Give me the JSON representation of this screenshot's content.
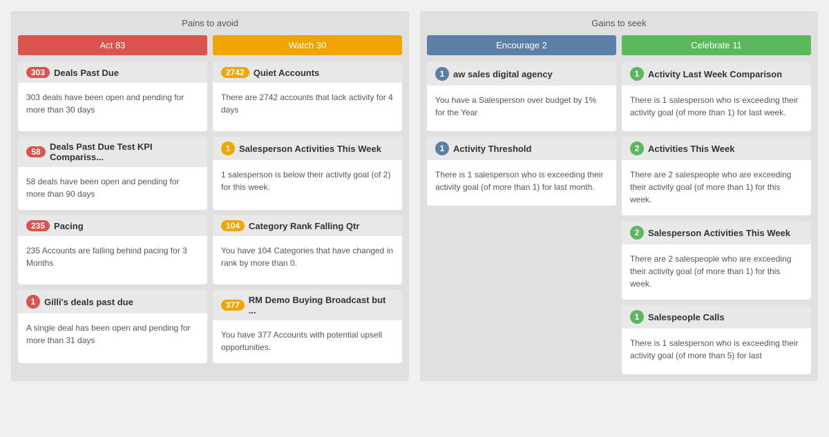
{
  "panels": [
    {
      "id": "pains",
      "title": "Pains to avoid",
      "tabs": [
        {
          "label": "Act  83",
          "color": "red"
        },
        {
          "label": "Watch  30",
          "color": "orange"
        }
      ],
      "cards": [
        {
          "badge": "303",
          "badge_color": "red",
          "title": "Deals Past Due",
          "body": "303 deals have been open and pending for more than 30 days"
        },
        {
          "badge": "2742",
          "badge_color": "orange",
          "title": "Quiet Accounts",
          "body": "There are 2742 accounts that lack activity for 4 days"
        },
        {
          "badge": "58",
          "badge_color": "red",
          "title": "Deals Past Due Test KPI Compariss...",
          "body": "58 deals have been open and pending for more than 90 days"
        },
        {
          "badge": "1",
          "badge_color": "orange",
          "badge_circle": true,
          "title": "Salesperson Activities This Week",
          "body": "1 salesperson is below their activity goal (of 2) for this week."
        },
        {
          "badge": "235",
          "badge_color": "red",
          "title": "Pacing",
          "body": "235 Accounts are falling behind pacing for 3 Months"
        },
        {
          "badge": "104",
          "badge_color": "orange",
          "title": "Category Rank Falling Qtr",
          "body": "You have 104 Categories that have changed in rank by more than 0."
        },
        {
          "badge": "1",
          "badge_color": "red",
          "badge_circle": true,
          "title": "Gilli's deals past due",
          "body": "A single deal has been open and pending for more than 31 days"
        },
        {
          "badge": "377",
          "badge_color": "orange",
          "title": "RM Demo Buying Broadcast but ...",
          "body": "You have 377 Accounts with potential upsell opportunities."
        }
      ]
    },
    {
      "id": "gains",
      "title": "Gains to seek",
      "tabs": [
        {
          "label": "Encourage  2",
          "color": "blue"
        },
        {
          "label": "Celebrate  11",
          "color": "green"
        }
      ],
      "cards": [
        {
          "badge": "1",
          "badge_color": "blue",
          "badge_circle": true,
          "title": "aw sales digital agency",
          "body": "You have a Salesperson over budget by 1% for the Year"
        },
        {
          "badge": "1",
          "badge_color": "green",
          "badge_circle": true,
          "title": "Activity Last Week Comparison",
          "body": "There is 1 salesperson who is exceeding their activity goal (of more than 1) for last week."
        },
        {
          "badge": "1",
          "badge_color": "blue",
          "badge_circle": true,
          "title": "Activity Threshold",
          "body": "There is 1 salesperson who is exceeding their activity goal (of more than 1) for last month."
        },
        {
          "badge": "2",
          "badge_color": "green",
          "badge_circle": true,
          "title": "Activities This Week",
          "body": "There are 2 salespeople who are exceeding their activity goal (of more than 1) for this week."
        },
        {
          "badge": "2",
          "badge_color": "green",
          "badge_circle": true,
          "title": "Salesperson Activities This Week",
          "body": "There are 2 salespeople who are exceeding their activity goal (of more than 1) for this week."
        },
        {
          "badge": "1",
          "badge_color": "green",
          "badge_circle": true,
          "title": "Salespeople Calls",
          "body": "There is 1 salesperson who is exceeding their activity goal (of more than 5) for last"
        }
      ]
    }
  ]
}
